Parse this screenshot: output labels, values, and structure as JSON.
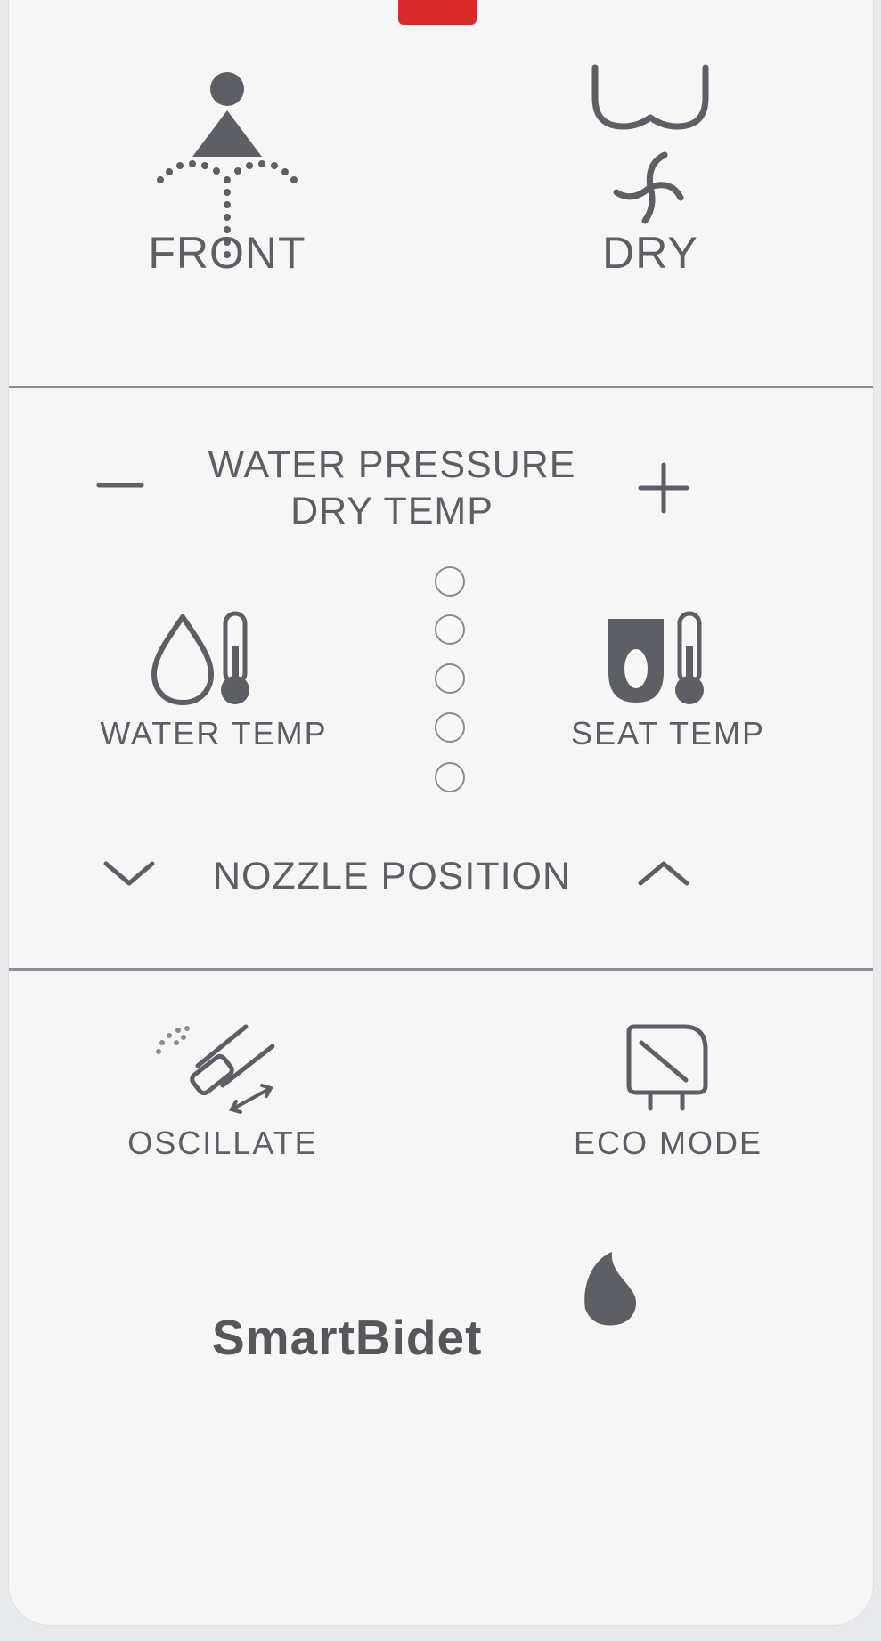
{
  "buttons": {
    "front": {
      "label": "FRONT",
      "icon": "front-wash-icon"
    },
    "dry": {
      "label": "DRY",
      "icon": "dry-fan-icon"
    },
    "minus": {
      "label": "–",
      "icon": "minus-icon"
    },
    "plus": {
      "label": "+",
      "icon": "plus-icon"
    },
    "water_temp": {
      "label": "WATER TEMP",
      "icon": "water-temp-icon"
    },
    "seat_temp": {
      "label": "SEAT TEMP",
      "icon": "seat-temp-icon"
    },
    "nozzle_down": {
      "icon": "chevron-down-icon"
    },
    "nozzle_up": {
      "icon": "chevron-up-icon"
    },
    "oscillate": {
      "label": "OSCILLATE",
      "icon": "oscillate-icon"
    },
    "eco_mode": {
      "label": "ECO MODE",
      "icon": "eco-mode-icon"
    }
  },
  "pressure_label": {
    "line1": "WATER PRESSURE",
    "line2": "DRY TEMP"
  },
  "nozzle_label": "NOZZLE POSITION",
  "level_leds": {
    "count": 5,
    "lit": 0
  },
  "brand": "SmartBidet",
  "colors": {
    "indicator": "#d92b2b",
    "icon": "#5d5f65",
    "panel": "#f6f6f7"
  }
}
